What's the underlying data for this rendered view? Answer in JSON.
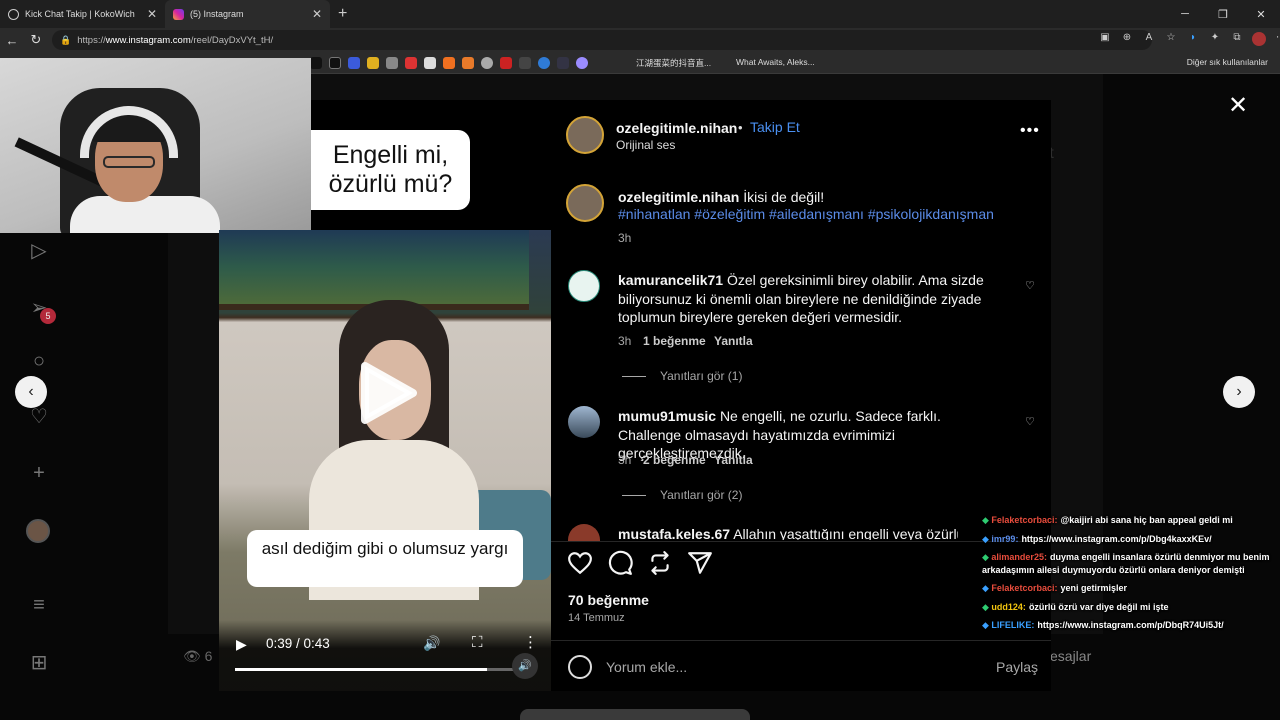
{
  "browser": {
    "tabs": [
      {
        "title": "Kick Chat Takip | KokoWich",
        "close": "✕"
      },
      {
        "title": "(5) Instagram",
        "close": "✕"
      }
    ],
    "new_tab": "+",
    "url_prefix": "https://",
    "url_domain": "www.instagram.com",
    "url_path": "/reel/DayDxVYt_tH/",
    "bookmarks": {
      "item1": "江湖蛋菜的抖音直...",
      "item2": "What Awaits, Aleks...",
      "right": "Diğer sık kullanılanlar"
    }
  },
  "ig_nav": {
    "notification_count": "5",
    "views_partial": "6",
    "messages_partial": "esajlar"
  },
  "video": {
    "caption_top": "Engelli mi, özürlü mü?",
    "caption_bottom": "asıl dediğim gibi o olumsuz yargı",
    "time": "0:39 / 0:43",
    "progress": 0.9
  },
  "post": {
    "username": "ozelegitimle.nihan",
    "separator": "•",
    "follow": "Takip Et",
    "audio": "Orijinal ses",
    "caption_user": "ozelegitimle.nihan",
    "caption_text": "İkisi de değil!",
    "hashtags": "#nihanatlan #özeleğitim #ailedanışmanı #psikolojikdanışman",
    "caption_time": "3h",
    "comments": [
      {
        "user": "kamurancelik71",
        "text": "Özel gereksinimli birey olabilir. Ama sizde biliyorsunuz ki önemli olan bireylere ne denildiğinde ziyade toplumun bireylere gereken değeri vermesidir.",
        "time": "3h",
        "likes": "1 beğenme",
        "reply": "Yanıtla",
        "view_replies": "Yanıtları gör (1)"
      },
      {
        "user": "mumu91music",
        "text": "Ne engelli, ne ozurlu. Sadece farklı. Challenge olmasaydı hayatımızda evrimimizi gerçekleştiremezdik.",
        "time": "3h",
        "likes": "2 beğenme",
        "reply": "Yanıtla",
        "view_replies": "Yanıtları gör (2)"
      }
    ],
    "partial_comment_user": "mustafa.keles.67",
    "partial_comment_text": "Allahın yaşattığını engelli veya özürlü",
    "like_count": "70 beğenme",
    "date": "14 Temmuz",
    "comment_placeholder": "Yorum ekle...",
    "share": "Paylaş"
  },
  "chat": [
    {
      "user": "Felaketcorbaci:",
      "text": "@kaijiri abi sana hiç ban appeal geldi mi",
      "user_color": "#e74c3c"
    },
    {
      "user": "imr99:",
      "text": "https://www.instagram.com/p/Dbg4kaxxKEv/",
      "user_color": "#5b8ce8"
    },
    {
      "user": "alimander25:",
      "text": "duyma engelli insanlara özürlü denmiyor mu benim arkadaşımın ailesi duymuyordu özürlü onlara deniyor demişti",
      "user_color": "#e74c3c"
    },
    {
      "user": "Felaketcorbaci:",
      "text": "yeni getirmişler",
      "user_color": "#e74c3c"
    },
    {
      "user": "udd124:",
      "text": "özürlü özrü var diye değil mi işte",
      "user_color": "#f1c40f"
    },
    {
      "user": "LIFELIKE:",
      "text": "https://www.instagram.com/p/DbqR74Ui5Jt/",
      "user_color": "#3aa0ff"
    }
  ]
}
